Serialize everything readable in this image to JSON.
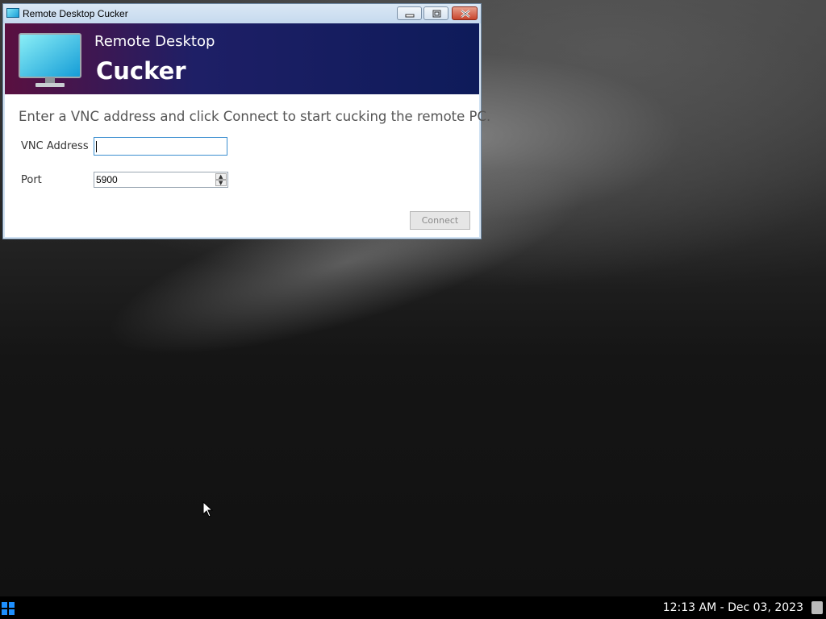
{
  "window": {
    "title": "Remote Desktop Cucker",
    "icon": "monitor-icon",
    "controls": [
      "minimize",
      "maximize",
      "close"
    ]
  },
  "banner": {
    "subtitle": "Remote Desktop",
    "title": "Cucker",
    "icon": "monitor-icon"
  },
  "form": {
    "instruction": "Enter a VNC address and click Connect to start cucking the remote PC.",
    "vnc_label": "VNC Address",
    "vnc_value": "",
    "port_label": "Port",
    "port_value": "5900",
    "connect_label": "Connect"
  },
  "taskbar": {
    "start_icon": "windows-start-icon",
    "clock": "12:13 AM - Dec 03, 2023",
    "notification_icon": "notification-icon"
  },
  "colors": {
    "banner_start": "#5a1040",
    "banner_end": "#0e1b5a",
    "input_focus": "#3c8fd0",
    "taskbar": "#000000"
  }
}
